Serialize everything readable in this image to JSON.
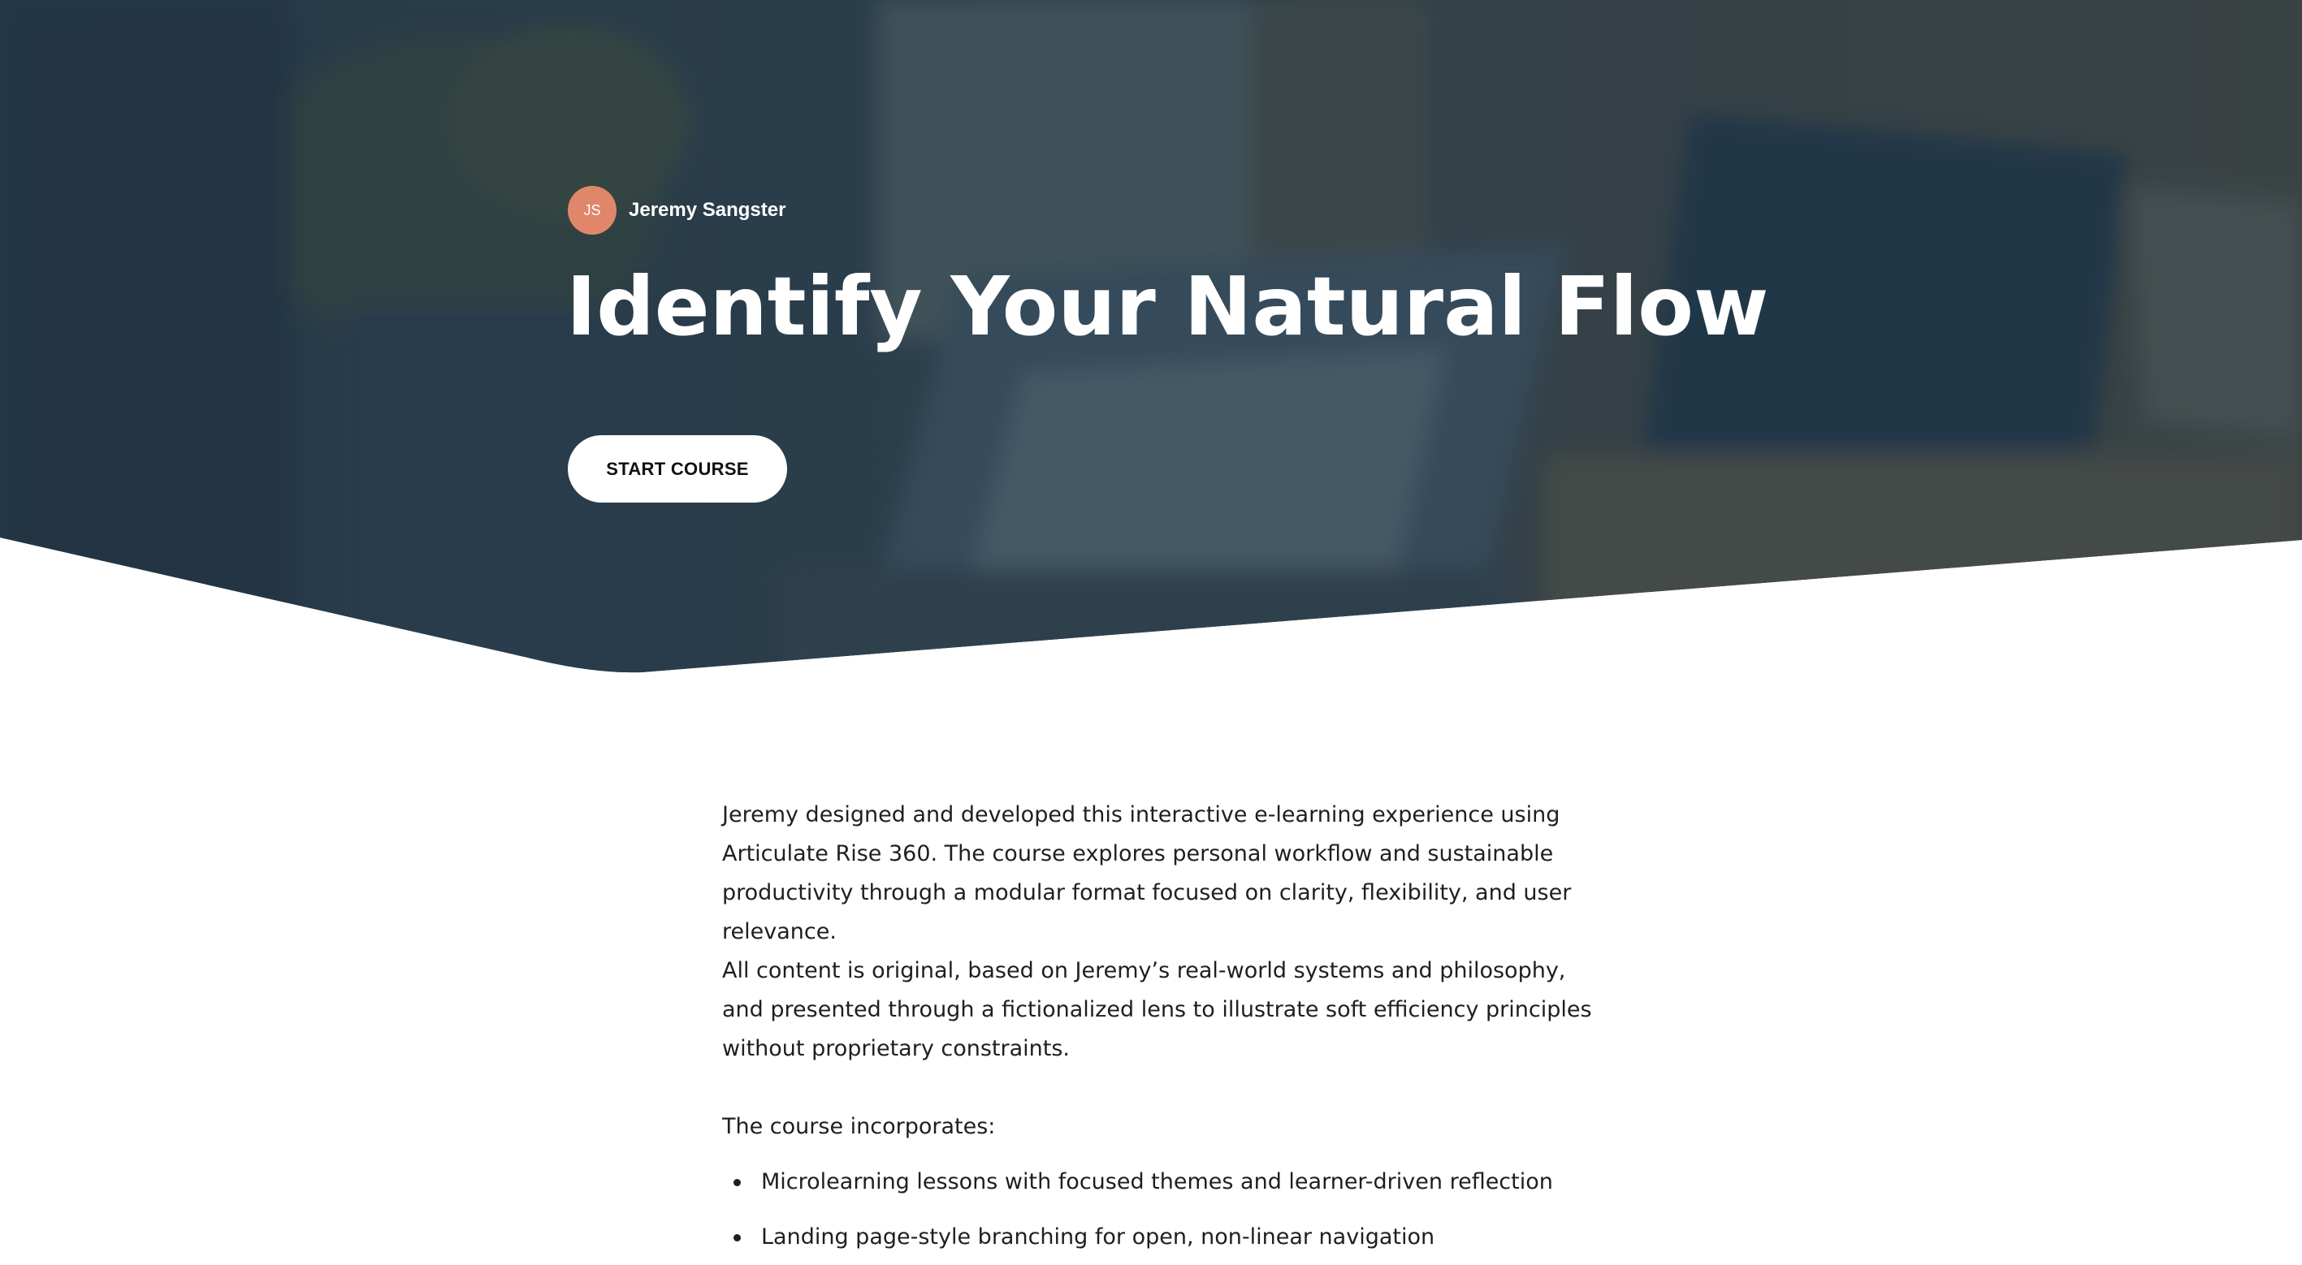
{
  "hero": {
    "author": {
      "initials": "JS",
      "name": "Jeremy Sangster",
      "avatar_color": "#e0876b"
    },
    "title": "Identify Your Natural Flow",
    "start_button_label": "START COURSE",
    "overlay_color": "#253849"
  },
  "description": {
    "paragraph_1": "Jeremy designed and developed this interactive e-learning experience using Articulate Rise 360. The course explores personal workflow and sustainable productivity through a modular format focused on clarity, flexibility, and user relevance.",
    "paragraph_2": "All content is original, based on Jeremy’s real-world systems and philosophy, and presented through a fictionalized lens to illustrate soft efficiency principles without proprietary constraints.",
    "list_intro": "The course incorporates:",
    "items": [
      "Microlearning lessons with focused themes and learner-driven reflection",
      "Landing page-style branching for open, non-linear navigation"
    ]
  }
}
